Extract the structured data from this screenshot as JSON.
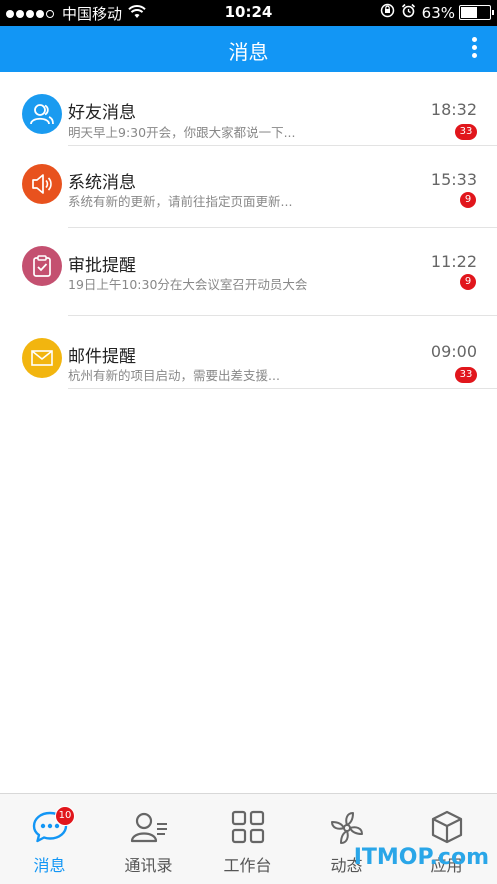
{
  "status_bar": {
    "carrier": "中国移动",
    "time": "10:24",
    "battery": "63%",
    "battery_level": 0.63
  },
  "nav": {
    "title": "消息"
  },
  "messages": [
    {
      "title": "好友消息",
      "subtitle": "明天早上9:30开会，你跟大家都说一下...",
      "time": "18:32",
      "badge": "33",
      "icon": "friends-icon",
      "color": "#1a9bf0"
    },
    {
      "title": "系统消息",
      "subtitle": "系统有新的更新，请前往指定页面更新...",
      "time": "15:33",
      "badge": "9",
      "icon": "speaker-icon",
      "color": "#e8521e"
    },
    {
      "title": "审批提醒",
      "subtitle": "19日上午10:30分在大会议室召开动员大会",
      "time": "11:22",
      "badge": "9",
      "icon": "clipboard-check-icon",
      "color": "#c45070"
    },
    {
      "title": "邮件提醒",
      "subtitle": "杭州有新的项目启动，需要出差支援...",
      "time": "09:00",
      "badge": "33",
      "icon": "mail-icon",
      "color": "#f2b50f"
    }
  ],
  "tabs": [
    {
      "label": "消息",
      "icon": "chat-bubble-icon",
      "active": true,
      "badge": "10"
    },
    {
      "label": "通讯录",
      "icon": "contacts-icon",
      "active": false
    },
    {
      "label": "工作台",
      "icon": "grid-icon",
      "active": false
    },
    {
      "label": "动态",
      "icon": "pinwheel-icon",
      "active": false
    },
    {
      "label": "应用",
      "icon": "cube-icon",
      "active": false
    }
  ],
  "watermark": "ITMOP.com",
  "colors": {
    "accent": "#1296f5",
    "badge": "#e1161c"
  }
}
